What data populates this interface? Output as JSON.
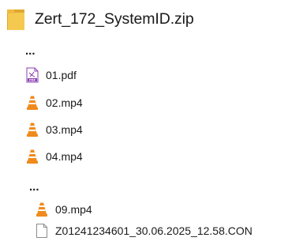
{
  "archive": {
    "name": "Zert_172_SystemID.zip",
    "icon": "folder-icon",
    "icon_color": "#f2c24c"
  },
  "ellipsis_1": "...",
  "ellipsis_2": "...",
  "files": [
    {
      "name": "01.pdf",
      "icon": "pdf-icon"
    },
    {
      "name": "02.mp4",
      "icon": "vlc-icon"
    },
    {
      "name": "03.mp4",
      "icon": "vlc-icon"
    },
    {
      "name": "04.mp4",
      "icon": "vlc-icon"
    },
    {
      "name": "09.mp4",
      "icon": "vlc-icon"
    },
    {
      "name": "Z01241234601_30.06.2025_12.58.CON",
      "icon": "blank-file-icon"
    }
  ],
  "colors": {
    "vlc_orange": "#f08a1c",
    "pdf_purple": "#8a3fb0"
  }
}
